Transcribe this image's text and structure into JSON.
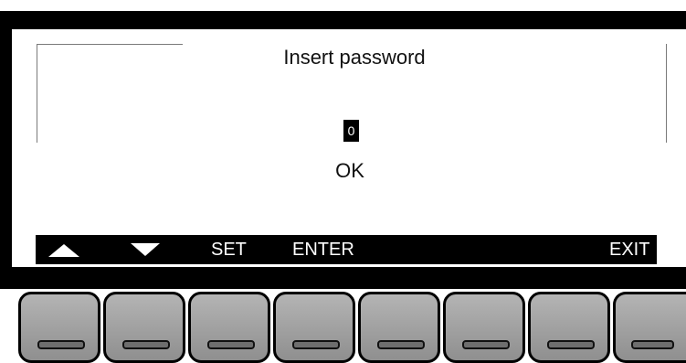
{
  "screen": {
    "title": "Insert password",
    "password_value": "0",
    "ok_label": "OK"
  },
  "softkeys": {
    "up_icon": "up-triangle",
    "down_icon": "down-triangle",
    "set": "SET",
    "enter": "ENTER",
    "exit": "EXIT"
  },
  "colors": {
    "bezel": "#000000",
    "lcd_background": "#ffffff",
    "softbar": "#000000",
    "key_face": "#a0a0a0"
  },
  "hardware_keys": [
    "key-1",
    "key-2",
    "key-3",
    "key-4",
    "key-5",
    "key-6",
    "key-7",
    "key-8"
  ]
}
